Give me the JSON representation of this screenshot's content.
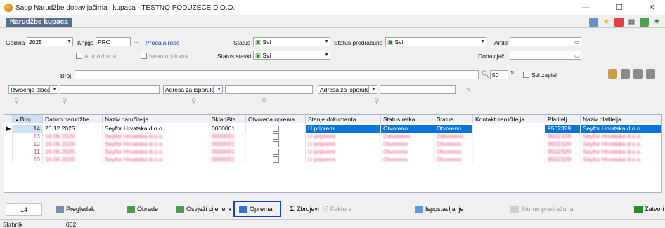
{
  "window": {
    "title": "Saop  Narudžbe dobavljačima i kupaca - TESTNO PODUZEĆE D.O.O.",
    "minimize": "—",
    "maximize": "☐",
    "close": "✕"
  },
  "module": {
    "title": "Narudžbe kupaca"
  },
  "filters": {
    "godina_label": "Godina",
    "godina_value": "2025",
    "knjiga_label": "Knjiga",
    "knjiga_value": "PRO",
    "knjiga_desc": "Prodaja robe",
    "knjiga_btn": "···",
    "autorizirana": "Autorizirana",
    "neautorizirana": "Neautorizirana",
    "status_label": "Status",
    "status_value": "Svi",
    "status_stavki_label": "Status stavki",
    "status_stavki_value": "Svi",
    "status_predracuna_label": "Status predračuna",
    "status_predracuna_value": "Svi",
    "artikl_label": "Artikl",
    "dobavljac_label": "Dobavljač",
    "broj_label": "Broj",
    "zoom_value": "50",
    "svi_zapisi": "Svi zapisi",
    "izvrsenje_label": "Izvršenje plaćanja",
    "adresa1_label": "Adresa za isporuku",
    "adresa2_label": "Adresa za isporuku"
  },
  "grid": {
    "columns": [
      "Broj",
      "Datum narudžbe",
      "Naziv naručitelja",
      "Skladište",
      "Otvorena oprema",
      "Stanje dokumenta",
      "Status retka",
      "Status",
      "Kontakt naručitelja",
      "Platitelj",
      "Naziv platitelja"
    ],
    "rows": [
      {
        "broj": "14",
        "datum": "20.12.2025",
        "narucitelj": "Seyfor Hrvatska d.o.o.",
        "skladiste": "0000001",
        "stanje": "U pripremi",
        "status_retka": "Otvoreno",
        "status": "Otvoreno",
        "kontakt": "",
        "platitelj": "9502329",
        "naziv_platitelja": "Seyfor Hrvatska d.o.o."
      },
      {
        "broj": "13",
        "datum": "16.06.2025",
        "narucitelj": "Seyfor Hrvatska d.o.o.",
        "skladiste": "0000001",
        "stanje": "U pripremi",
        "status_retka": "Zatvoreno",
        "status": "Zatvoreno",
        "kontakt": "",
        "platitelj": "9502329",
        "naziv_platitelja": "Seyfor Hrvatska d.o.o."
      },
      {
        "broj": "12",
        "datum": "16.06.2025",
        "narucitelj": "Seyfor Hrvatska d.o.o.",
        "skladiste": "0000001",
        "stanje": "U pripremi",
        "status_retka": "Otvoreno",
        "status": "Otvoreno",
        "kontakt": "",
        "platitelj": "9502329",
        "naziv_platitelja": "Seyfor Hrvatska d.o.o."
      },
      {
        "broj": "11",
        "datum": "16.06.2025",
        "narucitelj": "Seyfor Hrvatska d.o.o.",
        "skladiste": "0000001",
        "stanje": "U pripremi",
        "status_retka": "Otvoreno",
        "status": "Otvoreno",
        "kontakt": "",
        "platitelj": "9502329",
        "naziv_platitelja": "Seyfor Hrvatska d.o.o."
      },
      {
        "broj": "10",
        "datum": "16.06.2025",
        "narucitelj": "Seyfor Hrvatska d.o.o.",
        "skladiste": "0000001",
        "stanje": "U pripremi",
        "status_retka": "Otvoreno",
        "status": "Otvoreno",
        "kontakt": "",
        "platitelj": "9502329",
        "naziv_platitelja": "Seyfor Hrvatska d.o.o."
      }
    ]
  },
  "bottom": {
    "count": "14",
    "pregledak": "Pregledak",
    "obrade": "Obrade",
    "osvjezi_cijene": "Osvježi cijene",
    "oprema": "Oprema",
    "zbrojevi": "Zbrojevi",
    "faktura": "Faktura",
    "ispostavljanje": "Ispostavljanje",
    "storno": "Storno predračuna",
    "zatvori": "Zatvori"
  },
  "status": {
    "left": "Skrbnik",
    "code": "002"
  },
  "colors": {
    "selection": "#0a74d8",
    "highlight_border": "#1e3cc8",
    "redacted": "#e04878"
  }
}
